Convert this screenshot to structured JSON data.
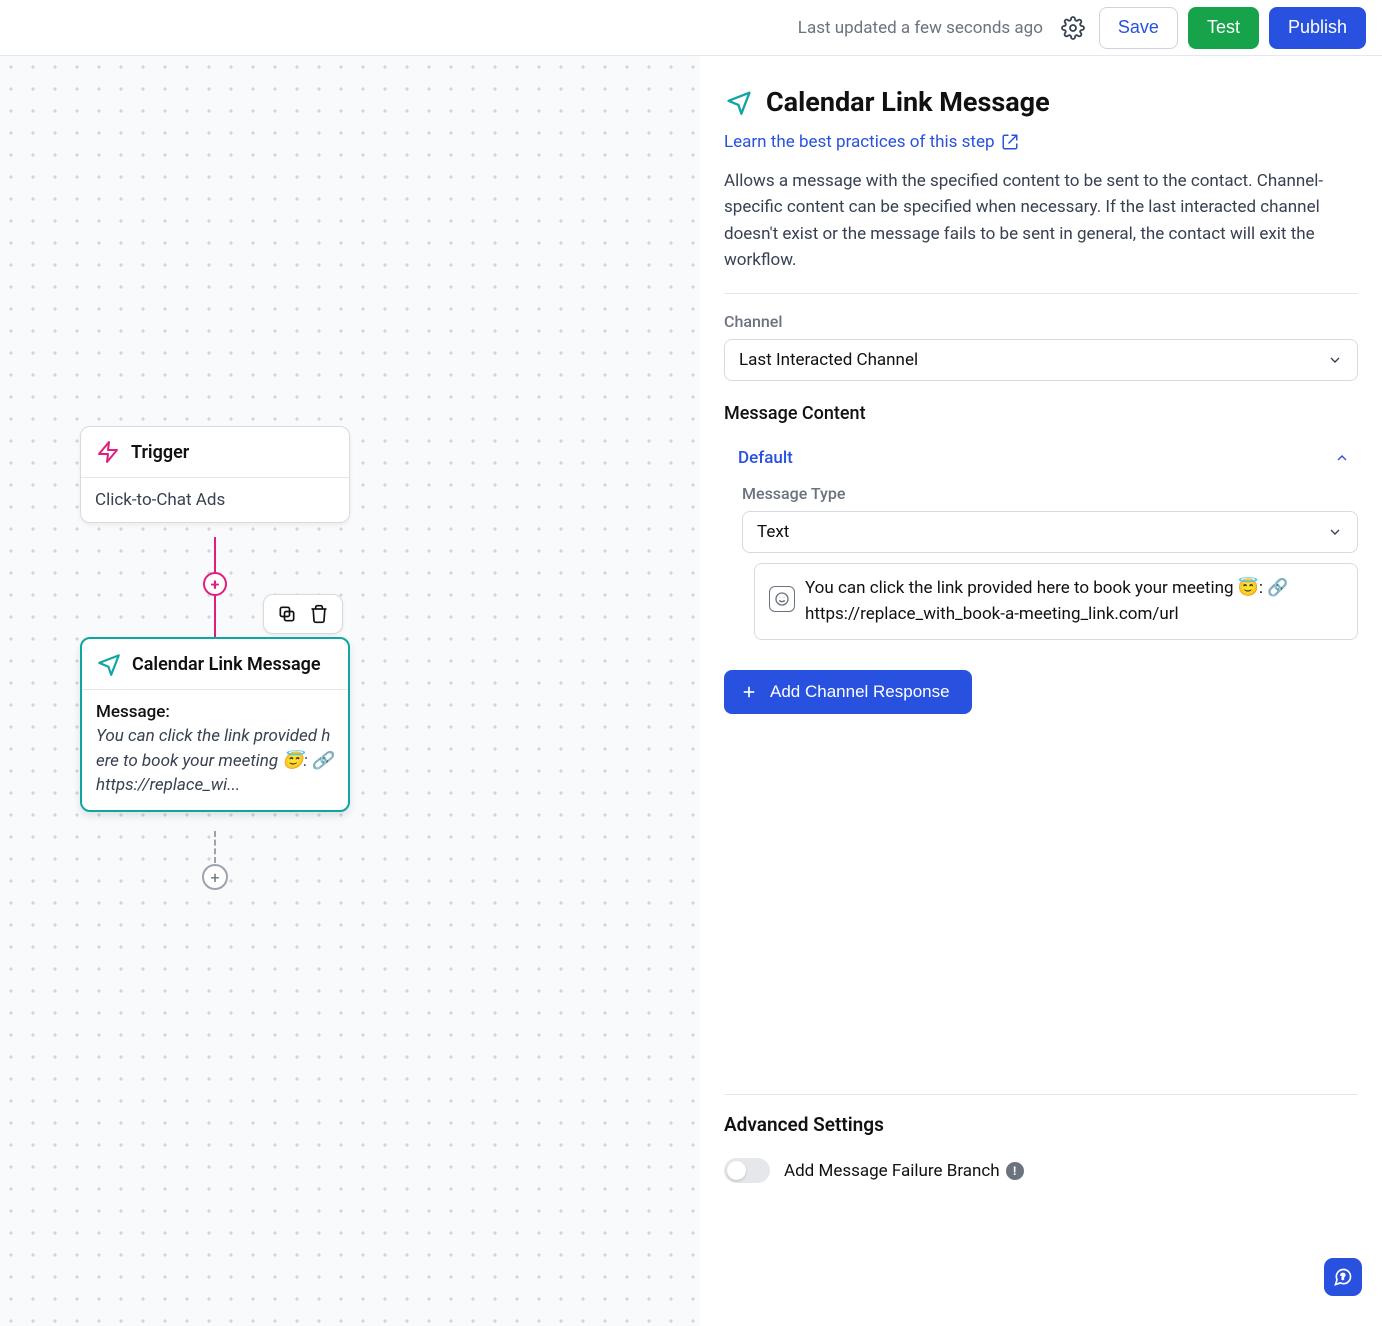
{
  "topbar": {
    "updated": "Last updated a few seconds ago",
    "save": "Save",
    "test": "Test",
    "publish": "Publish"
  },
  "canvas": {
    "trigger": {
      "title": "Trigger",
      "body": "Click-to-Chat Ads"
    },
    "message_node": {
      "title": "Calendar Link Message",
      "label": "Message:",
      "preview": "You can click the link provided here to book your meeting 😇: 🔗 https://replace_wi..."
    }
  },
  "panel": {
    "title": "Calendar Link Message",
    "learn_link": "Learn the best practices of this step",
    "description": "Allows a message with the specified content to be sent to the contact. Channel-specific content can be specified when necessary. If the last interacted channel doesn't exist or the message fails to be sent in general, the contact will exit the workflow.",
    "channel_label": "Channel",
    "channel_value": "Last Interacted Channel",
    "message_content_label": "Message Content",
    "default_label": "Default",
    "message_type_label": "Message Type",
    "message_type_value": "Text",
    "message_body": "You can click the link provided here to book your meeting 😇: 🔗 https://replace_with_book-a-meeting_link.com/url",
    "add_channel_response": "Add Channel Response",
    "advanced_settings": "Advanced Settings",
    "failure_branch_label": "Add Message Failure Branch"
  }
}
